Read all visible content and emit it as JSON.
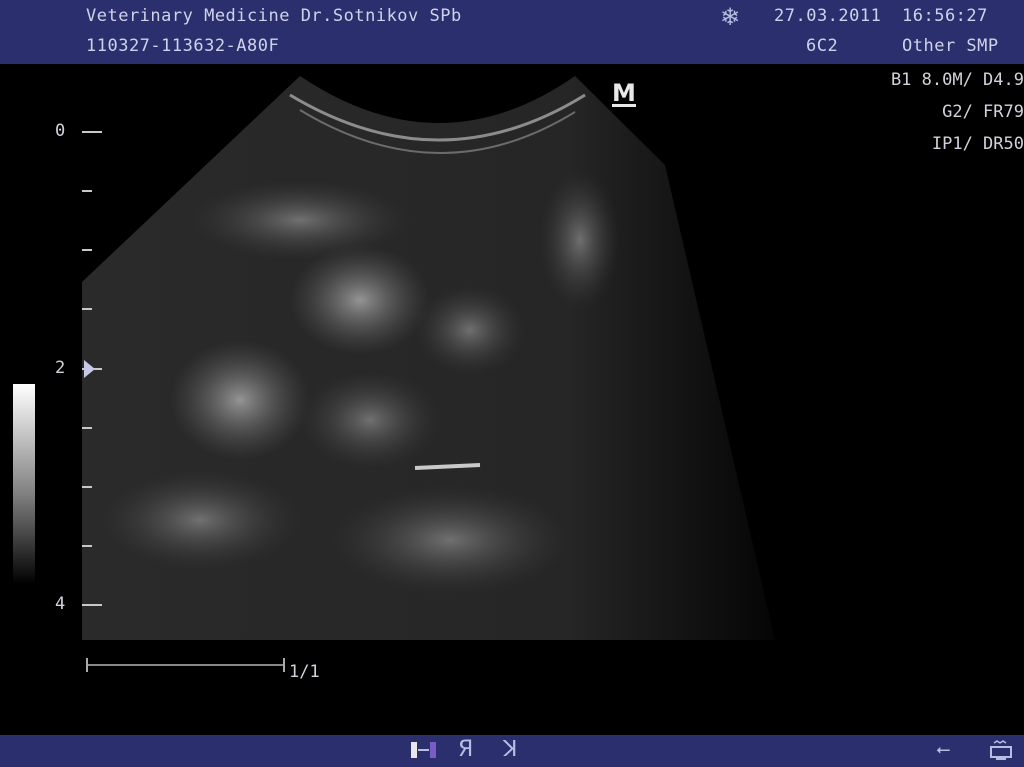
{
  "header": {
    "clinic": "Veterinary Medicine Dr.Sotnikov SPb",
    "patient_id": "110327-113632-A80F",
    "date": "27.03.2011",
    "time": "16:56:27",
    "probe": "6C2",
    "preset": "Other SMP"
  },
  "params": {
    "line1": "B1  8.0M/ D4.9",
    "line2": "G2/  FR79",
    "line3": "IP1/  DR50"
  },
  "depth_labels": [
    "0",
    "2",
    "4"
  ],
  "scale_label": "1/1",
  "logo": "M",
  "icons": {
    "freeze": "snowflake-icon",
    "grayscale": "grayscale-icon",
    "flip_r": "flip-r-icon",
    "flip_updown": "flip-updown-icon",
    "usb": "usb-icon",
    "storage": "storage-icon"
  },
  "colors": {
    "bar": "#2b2f6e"
  }
}
